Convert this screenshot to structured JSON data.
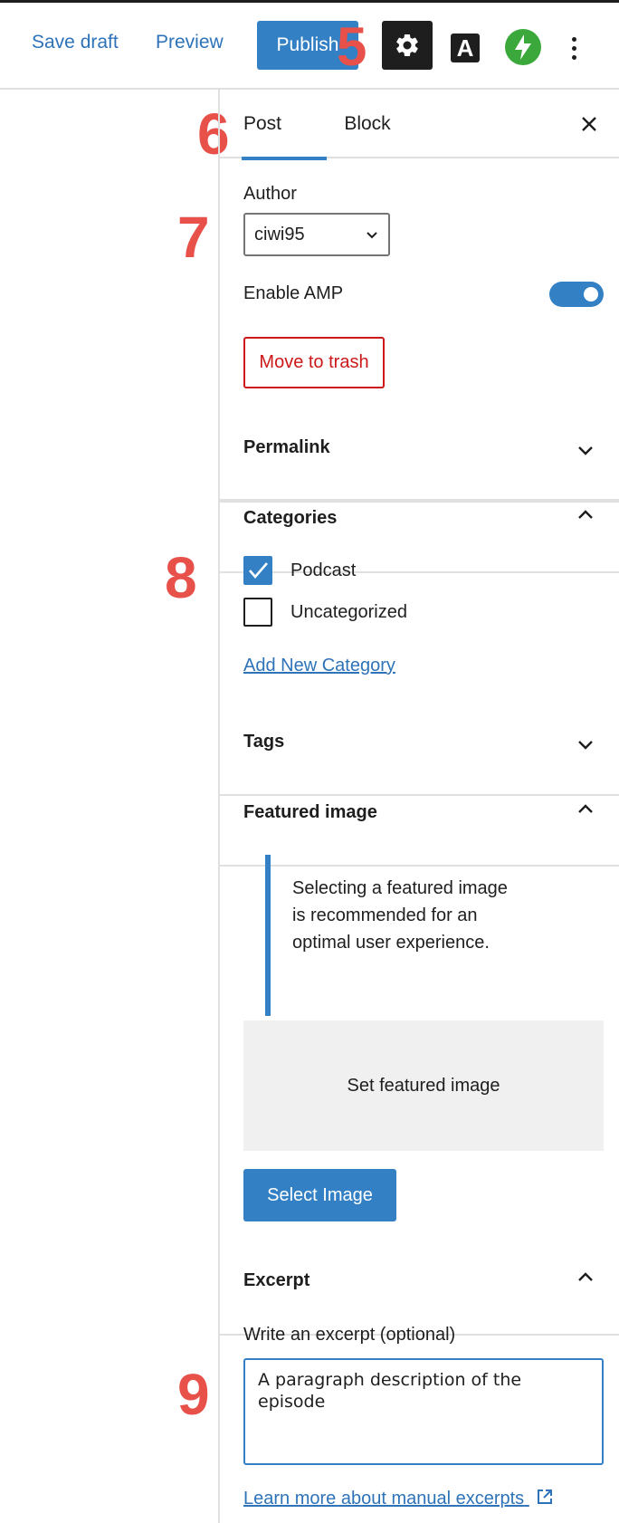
{
  "header": {
    "save_draft": "Save draft",
    "preview": "Preview",
    "publish": "Publish",
    "settings_icon": "gear-icon",
    "amp_icon_letter": "A",
    "jetpack_icon": "jetpack-bolt-icon",
    "more_icon": "vertical-ellipsis-icon"
  },
  "annotations": [
    "5",
    "6",
    "7",
    "8",
    "9"
  ],
  "tabs": {
    "post": "Post",
    "block": "Block",
    "close_icon": "close-icon"
  },
  "post_panel": {
    "author_label": "Author",
    "author_value": "ciwi95",
    "amp_label": "Enable AMP",
    "amp_enabled": true,
    "trash_label": "Move to trash"
  },
  "permalink": {
    "title": "Permalink",
    "expanded": false
  },
  "categories": {
    "title": "Categories",
    "expanded": true,
    "items": [
      {
        "label": "Podcast",
        "checked": true
      },
      {
        "label": "Uncategorized",
        "checked": false
      }
    ],
    "add_new": "Add New Category"
  },
  "tags": {
    "title": "Tags",
    "expanded": false
  },
  "featured_image": {
    "title": "Featured image",
    "expanded": true,
    "notice": "Selecting a featured image is recommended for an optimal user experience.",
    "set_label": "Set featured image",
    "select_button": "Select Image"
  },
  "excerpt": {
    "title": "Excerpt",
    "expanded": true,
    "field_label": "Write an excerpt (optional)",
    "value": "A paragraph description of the episode",
    "learn_more": "Learn more about manual excerpts"
  },
  "colors": {
    "accent": "#3380c5",
    "link": "#2e73b8",
    "destructive": "#cc1818",
    "annotation": "#e8504a",
    "jetpack": "#3aa83a"
  }
}
